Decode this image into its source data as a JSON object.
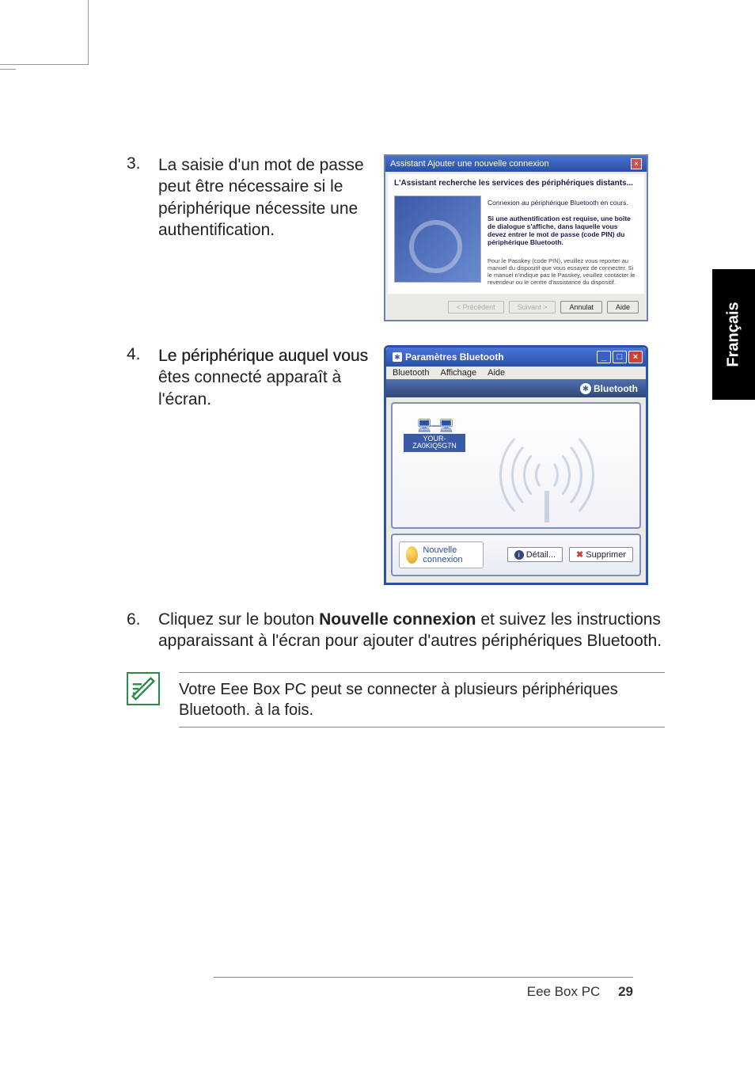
{
  "language_tab": "Français",
  "steps": {
    "s3": {
      "num": "3.",
      "text": "La saisie d'un mot de passe peut être nécessaire si le périphérique nécessite une authentification."
    },
    "s4": {
      "num": "4.",
      "text_lead": "Le périphérique auquel vous",
      "text_rest": " êtes connecté apparaît à l'écran."
    },
    "s6": {
      "num": "6.",
      "text_a": "Cliquez sur le bouton ",
      "text_bold": "Nouvelle connexion",
      "text_b": " et suivez les instructions apparaissant à l'écran pour ajouter d'autres périphériques Bluetooth."
    }
  },
  "note": "Votre Eee Box PC peut se connecter à plusieurs périphériques Bluetooth. à la fois.",
  "dialog1": {
    "title": "Assistant Ajouter une nouvelle connexion",
    "subtitle": "L'Assistant recherche les services des périphériques distants...",
    "line1": "Connexion au périphérique Bluetooth en cours.",
    "line2": "Si une authentification est requise, une boîte de dialogue s'affiche, dans laquelle vous devez entrer le mot de passe (code PIN) du périphérique Bluetooth.",
    "line3": "Pour le Passkey (code PIN), veuillez vous reporter au manuel du dispositif que vous essayez de connecter. Si le manuel n'indique pas le Passkey, veuillez contacter le revendeur ou le centre d'assistance du dispositif.",
    "btn_prev": "< Précédent",
    "btn_next": "Suivant >",
    "btn_cancel": "Annulat",
    "btn_help": "Aide"
  },
  "dialog2": {
    "title": "Paramètres Bluetooth",
    "menu": {
      "bluetooth": "Bluetooth",
      "affichage": "Affichage",
      "aide": "Aide"
    },
    "brand": "Bluetooth",
    "device_name": "YOUR-ZA0KIQ5G7N",
    "new_connection": "Nouvelle connexion",
    "btn_detail": "Détail...",
    "btn_delete": "Supprimer"
  },
  "footer": {
    "product": "Eee Box PC",
    "page": "29"
  }
}
